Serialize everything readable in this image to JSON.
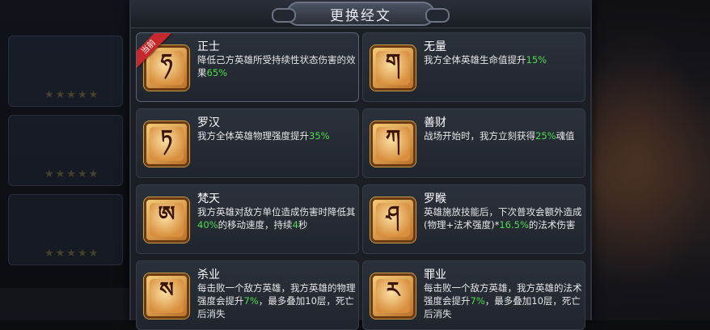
{
  "dialog": {
    "title": "更换经文"
  },
  "scriptures": [
    {
      "name": "正士",
      "glyph": "ཧ",
      "current": true,
      "current_label": "当前",
      "desc": [
        {
          "t": "降低己方英雄所受持续性状态伤害的效果"
        },
        {
          "t": "65%",
          "hl": true
        }
      ]
    },
    {
      "name": "无量",
      "glyph": "ག",
      "current": false,
      "desc": [
        {
          "t": "我方全体英雄生命值提升"
        },
        {
          "t": "15%",
          "hl": true
        }
      ]
    },
    {
      "name": "罗汉",
      "glyph": "ཏ",
      "current": false,
      "desc": [
        {
          "t": "我方全体英雄物理强度提升"
        },
        {
          "t": "35%",
          "hl": true
        }
      ]
    },
    {
      "name": "善财",
      "glyph": "ཀ",
      "current": false,
      "desc": [
        {
          "t": "战场开始时，我方立刻获得"
        },
        {
          "t": "25%",
          "hl": true
        },
        {
          "t": "魂值"
        }
      ]
    },
    {
      "name": "梵天",
      "glyph": "ཨ",
      "current": false,
      "desc": [
        {
          "t": "我方英雄对敌方单位造成伤害时降低其"
        },
        {
          "t": "40%",
          "hl": true
        },
        {
          "t": "的移动速度，持续"
        },
        {
          "t": "4",
          "hl": true
        },
        {
          "t": "秒"
        }
      ]
    },
    {
      "name": "罗睺",
      "glyph": "ཤ",
      "current": false,
      "desc": [
        {
          "t": "英雄施放技能后，下次普攻会额外造成(物理+法术强度)*"
        },
        {
          "t": "16.5%",
          "hl": true
        },
        {
          "t": "的法术伤害"
        }
      ]
    },
    {
      "name": "杀业",
      "glyph": "ས",
      "current": false,
      "desc": [
        {
          "t": "每击败一个敌方英雄，我方英雄的物理强度会提升"
        },
        {
          "t": "7%",
          "hl": true
        },
        {
          "t": "，最多叠加10层，死亡后消失"
        }
      ]
    },
    {
      "name": "罪业",
      "glyph": "ར",
      "current": false,
      "desc": [
        {
          "t": "每击败一个敌方英雄，我方英雄的法术强度会提升"
        },
        {
          "t": "7%",
          "hl": true
        },
        {
          "t": "，最多叠加10层，死亡后消失"
        }
      ]
    }
  ],
  "colors": {
    "highlight": "#4fdc4f",
    "ribbon": "#c8282b",
    "icon_gold": "#f6d07a"
  }
}
